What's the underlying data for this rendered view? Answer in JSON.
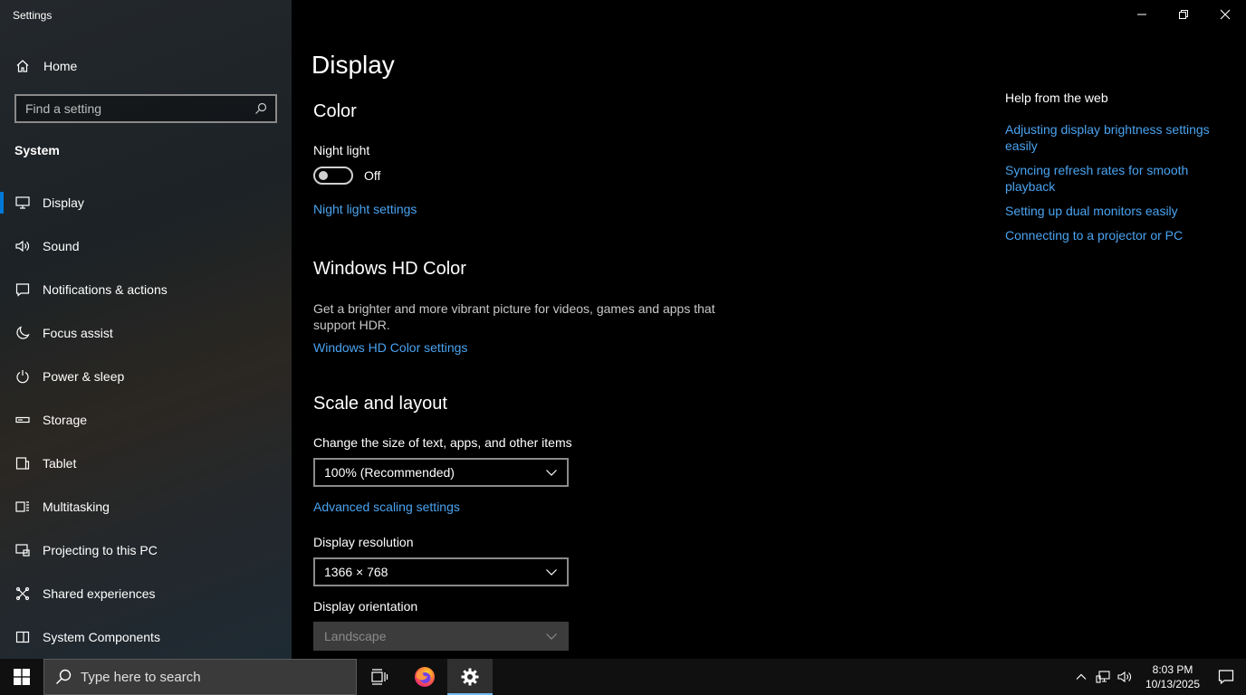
{
  "window": {
    "title": "Settings"
  },
  "sidebar": {
    "home_label": "Home",
    "search_placeholder": "Find a setting",
    "section_label": "System",
    "items": [
      {
        "label": "Display",
        "icon": "monitor-icon",
        "active": true
      },
      {
        "label": "Sound",
        "icon": "speaker-icon"
      },
      {
        "label": "Notifications & actions",
        "icon": "notification-icon"
      },
      {
        "label": "Focus assist",
        "icon": "moon-icon"
      },
      {
        "label": "Power & sleep",
        "icon": "power-icon"
      },
      {
        "label": "Storage",
        "icon": "storage-icon"
      },
      {
        "label": "Tablet",
        "icon": "tablet-icon"
      },
      {
        "label": "Multitasking",
        "icon": "multitasking-icon"
      },
      {
        "label": "Projecting to this PC",
        "icon": "projecting-icon"
      },
      {
        "label": "Shared experiences",
        "icon": "shared-icon"
      },
      {
        "label": "System Components",
        "icon": "components-icon"
      }
    ]
  },
  "main": {
    "page_title": "Display",
    "color": {
      "heading": "Color",
      "night_light_label": "Night light",
      "night_light_state": "Off",
      "night_light_settings_link": "Night light settings"
    },
    "hd_color": {
      "heading": "Windows HD Color",
      "description": "Get a brighter and more vibrant picture for videos, games and apps that support HDR.",
      "settings_link": "Windows HD Color settings"
    },
    "scale_layout": {
      "heading": "Scale and layout",
      "size_label": "Change the size of text, apps, and other items",
      "size_value": "100% (Recommended)",
      "advanced_link": "Advanced scaling settings",
      "resolution_label": "Display resolution",
      "resolution_value": "1366 × 768",
      "orientation_label": "Display orientation",
      "orientation_value": "Landscape"
    },
    "help": {
      "title": "Help from the web",
      "links": [
        "Adjusting display brightness settings easily",
        "Syncing refresh rates for smooth playback",
        "Setting up dual monitors easily",
        "Connecting to a projector or PC"
      ]
    }
  },
  "taskbar": {
    "search_text": "Type here to search",
    "time": "8:03 PM",
    "date": "10/13/2025"
  },
  "colors": {
    "accent": "#0078d7",
    "link": "#4aa3f0"
  }
}
